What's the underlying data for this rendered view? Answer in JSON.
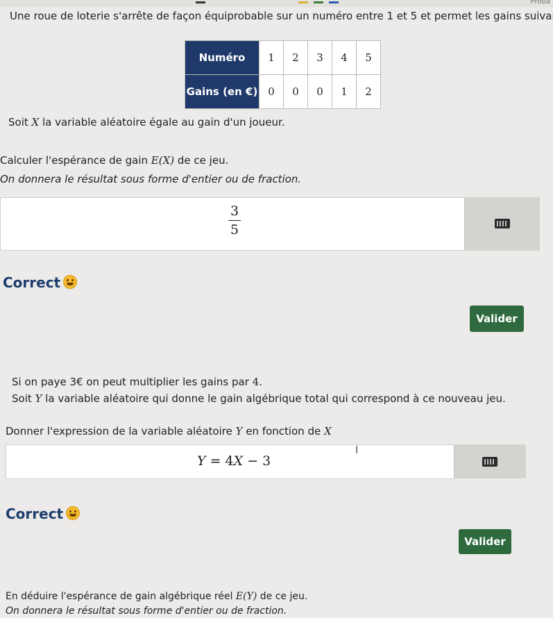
{
  "topbar": {
    "app_label": "Proba"
  },
  "problem": {
    "intro": "Une roue de loterie s'arrête de façon équiprobable sur un numéro entre 1 et 5 et permet les gains suivants :",
    "table": {
      "row1_header": "Numéro",
      "row2_header": "Gains (en €)",
      "numbers": [
        "1",
        "2",
        "3",
        "4",
        "5"
      ],
      "gains": [
        "0",
        "0",
        "0",
        "1",
        "2"
      ]
    },
    "var_def_prefix": "Soit ",
    "var_def_var": "X",
    "var_def_suffix": " la variable aléatoire égale au gain d'un joueur."
  },
  "q1": {
    "prompt_prefix": "Calculer l'espérance de gain ",
    "prompt_math": "E(X)",
    "prompt_suffix": " de ce jeu.",
    "instruction": "On donnera le résultat sous forme d'entier ou de fraction.",
    "answer_num": "3",
    "answer_den": "5",
    "feedback": "Correct",
    "submit_label": "Valider"
  },
  "q2": {
    "context_prefix": "Si on paye 3€ on peut multiplier les gains par ",
    "context_num": "4.",
    "vardef_prefix": "Soit ",
    "vardef_var": "Y",
    "vardef_suffix": " la variable aléatoire qui donne le gain algébrique total qui correspond à ce nouveau jeu.",
    "prompt_prefix": "Donner l'expression de la variable aléatoire ",
    "prompt_var1": "Y",
    "prompt_mid": " en fonction de ",
    "prompt_var2": "X",
    "answer_lhs": "Y",
    "answer_eq": " = 4",
    "answer_x": "X",
    "answer_rest": " − 3",
    "feedback": "Correct",
    "submit_label": "Valider"
  },
  "q3": {
    "prompt_prefix": "En déduire l'espérance de gain algébrique réel ",
    "prompt_math": "E(Y)",
    "prompt_suffix": " de ce jeu.",
    "instruction": "On donnera le résultat sous forme d'entier ou de fraction."
  },
  "colors": {
    "table_header_bg": "#1f3a6a",
    "correct_text": "#1e3d6e",
    "button_bg": "#2f6a3f"
  },
  "icons": [
    "keyboard-icon",
    "smiley-icon",
    "text-cursor-icon"
  ]
}
